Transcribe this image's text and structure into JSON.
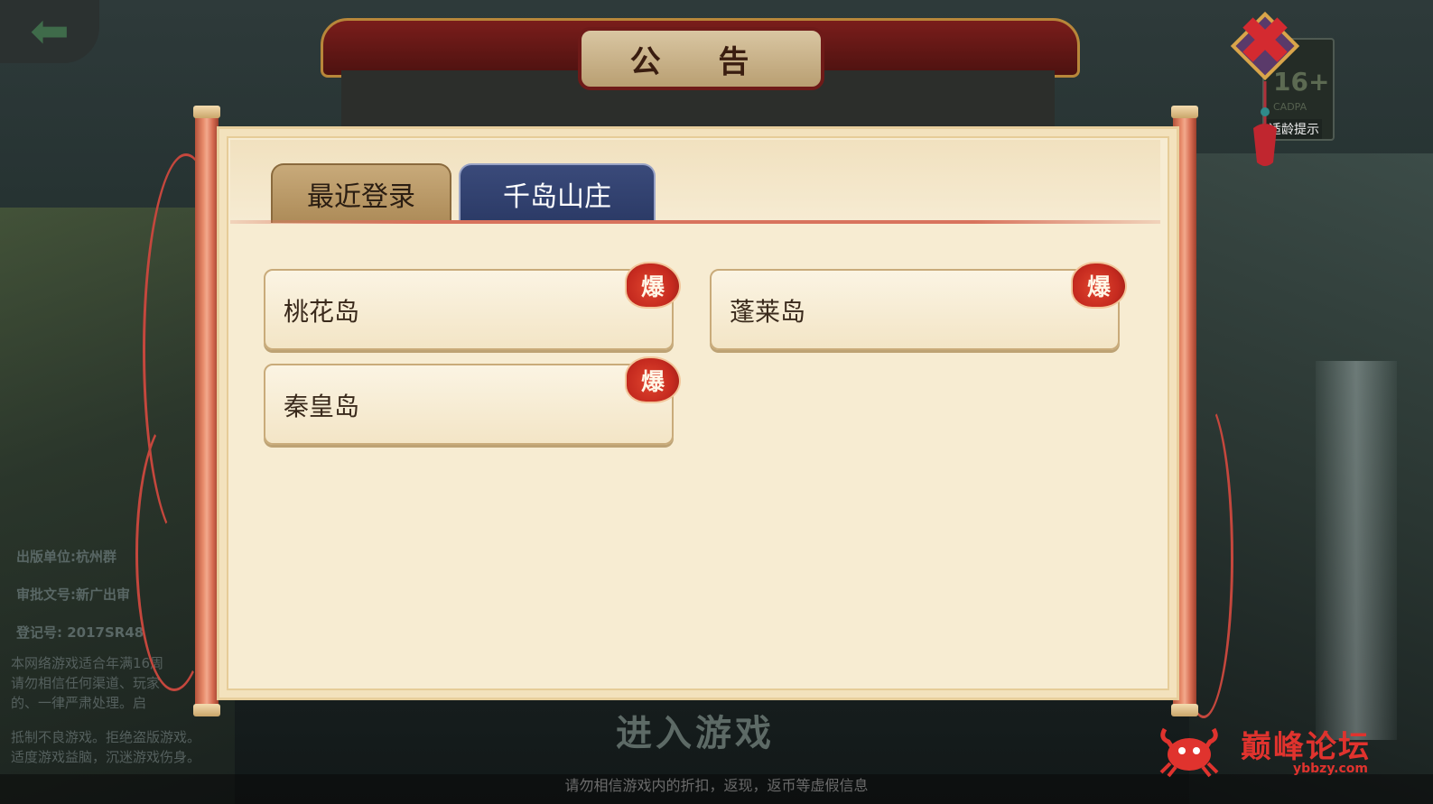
{
  "top_left": {
    "back_icon": "back-arrow-icon"
  },
  "notice": {
    "title": "公 告"
  },
  "age_badge": {
    "number": "16+",
    "org": "CADPA",
    "tip": "适龄提示"
  },
  "close": {
    "icon": "close-x-icon"
  },
  "tabs": [
    {
      "label": "最近登录",
      "active": false
    },
    {
      "label": "千岛山庄",
      "active": true
    }
  ],
  "servers": [
    {
      "name": "桃花岛",
      "badge": "爆"
    },
    {
      "name": "蓬莱岛",
      "badge": "爆"
    },
    {
      "name": "秦皇岛",
      "badge": "爆"
    }
  ],
  "background": {
    "credits": [
      "出版单位:杭州群",
      "审批文号:新广出审",
      "登记号: 2017SR48"
    ],
    "footer_lines": [
      "本网络游戏适合年满16周",
      "请勿相信任何渠道、玩家",
      "的、一律严肃处理。启"
    ],
    "footer_lines2": [
      "抵制不良游戏。拒绝盗版游戏。",
      "适度游戏益脑，沉迷游戏伤身。"
    ],
    "enter_game": "进入游戏",
    "bottom_warning": "请勿相信游戏内的折扣，返现，返币等虚假信息"
  },
  "watermark": {
    "name": "巅峰论坛",
    "url": "ybbzy.com"
  },
  "colors": {
    "panel": "#f7ecd2",
    "tab_active": "#2b3a66",
    "tab_inactive": "#ad8b58",
    "hot_badge": "#c52a1f",
    "accent_red": "#e0332e"
  }
}
